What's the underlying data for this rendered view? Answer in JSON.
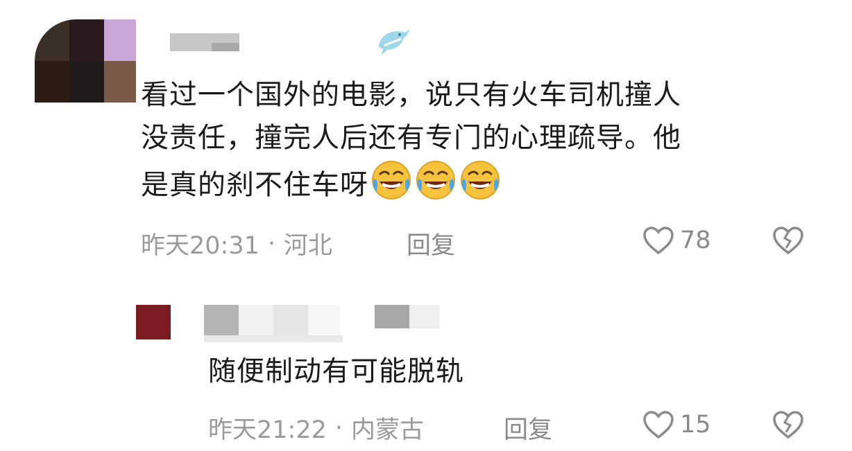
{
  "comments": [
    {
      "text_line1": "看过一个国外的电影，说只有火车司机撞人",
      "text_line2": "没责任，撞完人后还有专门的心理疏导。他",
      "text_line3": "是真的刹不住车呀",
      "emoji_icon": "rolling-on-floor-laughing-emoji",
      "emoji_count": 3,
      "time": "昨天20:31",
      "dot": "·",
      "location": "河北",
      "reply_label": "回复",
      "likes": "78",
      "badge_icon": "dolphin-icon"
    },
    {
      "text": "随便制动有可能脱轨",
      "time": "昨天21:22",
      "dot": "·",
      "location": "内蒙古",
      "reply_label": "回复",
      "likes": "15"
    }
  ],
  "colors": {
    "text": "#1b1b1b",
    "meta": "#9a9a9a",
    "icon": "#8a8a8a"
  }
}
